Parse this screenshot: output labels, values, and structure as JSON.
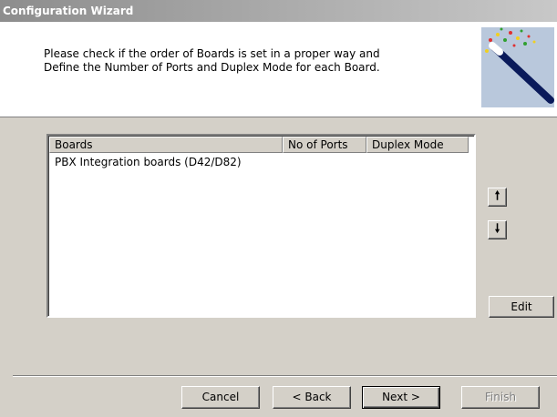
{
  "window": {
    "title": "Configuration Wizard"
  },
  "header": {
    "instruction": "Please check if the order of Boards is set in a proper way and Define the Number of Ports and Duplex Mode for each Board.",
    "image_icon": "wizard-wand-icon"
  },
  "boards_list": {
    "columns": [
      "Boards",
      "No of Ports",
      "Duplex Mode"
    ],
    "rows": [
      {
        "board": "PBX Integration boards (D42/D82)",
        "ports": "",
        "duplex": ""
      }
    ]
  },
  "side_buttons": {
    "move_up_icon": "arrow-up-icon",
    "move_up_glyph": "🠕",
    "move_down_icon": "arrow-down-icon",
    "move_down_glyph": "🠗",
    "edit_label": "Edit"
  },
  "footer": {
    "cancel_label": "Cancel",
    "back_label": "< Back",
    "next_label": "Next >",
    "finish_label": "Finish"
  },
  "colors": {
    "dialog_bg": "#d4d0c8",
    "header_bg": "#ffffff",
    "disabled_text": "#808080"
  }
}
